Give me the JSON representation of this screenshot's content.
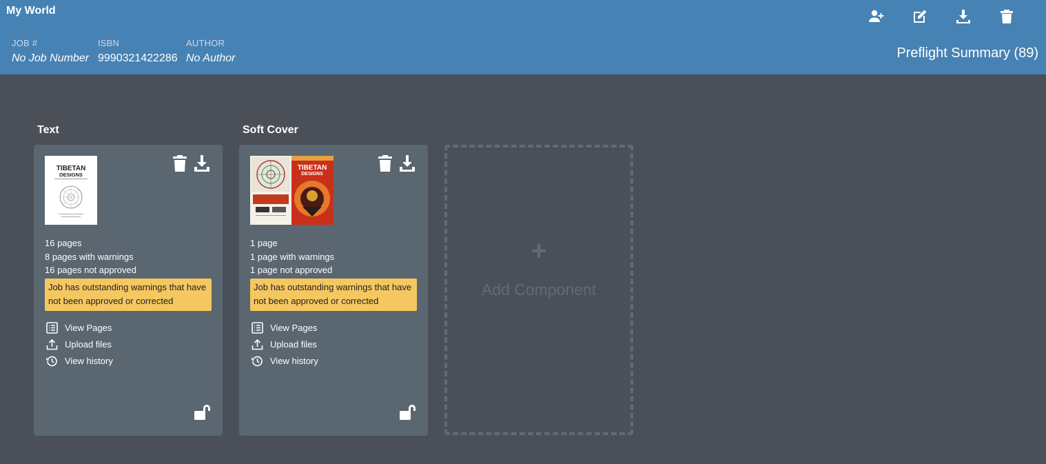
{
  "header": {
    "title": "My World",
    "job_label": "JOB #",
    "job_value": "No Job Number",
    "isbn_label": "ISBN",
    "isbn_value": "9990321422286",
    "author_label": "AUTHOR",
    "author_value": "No Author",
    "summary": "Preflight Summary (89)",
    "actions": [
      "add-user-icon",
      "edit-icon",
      "download-icon",
      "trash-icon"
    ]
  },
  "components": [
    {
      "title": "Text",
      "pages": "16 pages",
      "warnings": "8 pages with warnings",
      "not_approved": "16 pages not approved",
      "alert": "Job has outstanding warnings that have not been approved or corrected",
      "thumb_title": "TIBETAN",
      "thumb_subtitle": "DESIGNS",
      "links": [
        "View Pages",
        "Upload files",
        "View history"
      ]
    },
    {
      "title": "Soft Cover",
      "pages": "1 page",
      "warnings": "1 page with warnings",
      "not_approved": "1 page not approved",
      "alert": "Job has outstanding warnings that have not been approved or corrected",
      "thumb_title": "TIBETAN",
      "thumb_subtitle": "DESIGNS",
      "links": [
        "View Pages",
        "Upload files",
        "View history"
      ]
    }
  ],
  "add_component": {
    "plus": "+",
    "label": "Add Component"
  },
  "colors": {
    "header": "#4682b4",
    "background": "#4a4f58",
    "card": "#5a6670",
    "warning": "#f5c760"
  }
}
